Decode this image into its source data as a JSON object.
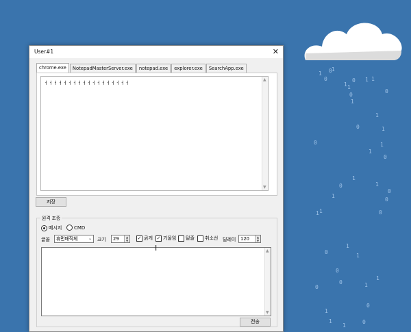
{
  "window": {
    "title": "User#1",
    "close_label": "✕"
  },
  "tabs": [
    {
      "label": "chrome.exe",
      "active": true
    },
    {
      "label": "NotepadMasterServer.exe",
      "active": false
    },
    {
      "label": "notepad.exe",
      "active": false
    },
    {
      "label": "explorer.exe",
      "active": false
    },
    {
      "label": "SearchApp.exe",
      "active": false
    }
  ],
  "log_text": "ㅓㅓㅓㅓㅓㅓㅓㅓㅓㅓㅓㅓㅓㅓㅓㅓㅓㅓ",
  "save_button": "저장",
  "remote": {
    "group_label": "원격 조종",
    "mode_message": "메시지",
    "mode_cmd": "CMD",
    "font_label": "글꼴",
    "font_value": "휴먼매직체",
    "size_label": "크기",
    "size_value": "29",
    "bold_label": "굵게",
    "italic_label": "기울임",
    "underline_label": "밑줄",
    "strike_label": "취소선",
    "delay_label": "딜레이",
    "delay_value": "120",
    "send_button": "전송"
  },
  "background_digits": "1 0 1 0 1 1 0 1 1 0 0 1 1 0 1 0 1 1 0 0 1 1 0 1 0 1 1 0 1 0 0 1 0 1 0 1 1 0 1 1 0",
  "colors": {
    "desktop": "#3a74ad",
    "cloud": "#ffffff",
    "digits": "#9fc3e8"
  }
}
